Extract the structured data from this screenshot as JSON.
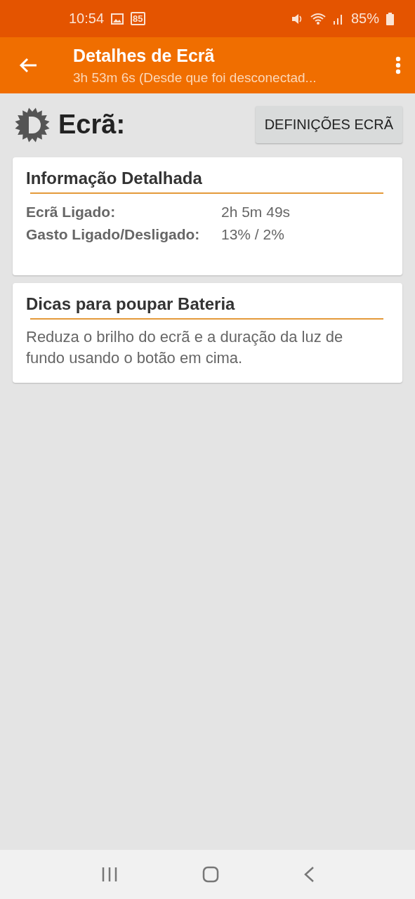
{
  "status_bar": {
    "time": "10:54",
    "calendar_badge": "85",
    "battery": "85%"
  },
  "app_bar": {
    "title": "Detalhes de Ecrã",
    "subtitle": "3h 53m 6s (Desde que foi desconectad..."
  },
  "header": {
    "title": "Ecrã:",
    "button": "DEFINIÇÕES ECRÃ"
  },
  "cards": [
    {
      "kind": "table",
      "title": "Informação Detalhada",
      "rows": [
        {
          "label": "Ecrã Ligado:",
          "value": "2h 5m 49s"
        },
        {
          "label": "Gasto Ligado/Desligado:",
          "value": "13% / 2%"
        }
      ]
    },
    {
      "kind": "text",
      "title": "Dicas para poupar Bateria",
      "text": "Reduza o brilho do ecrã e a duração da luz de fundo usando o botão em cima."
    }
  ]
}
